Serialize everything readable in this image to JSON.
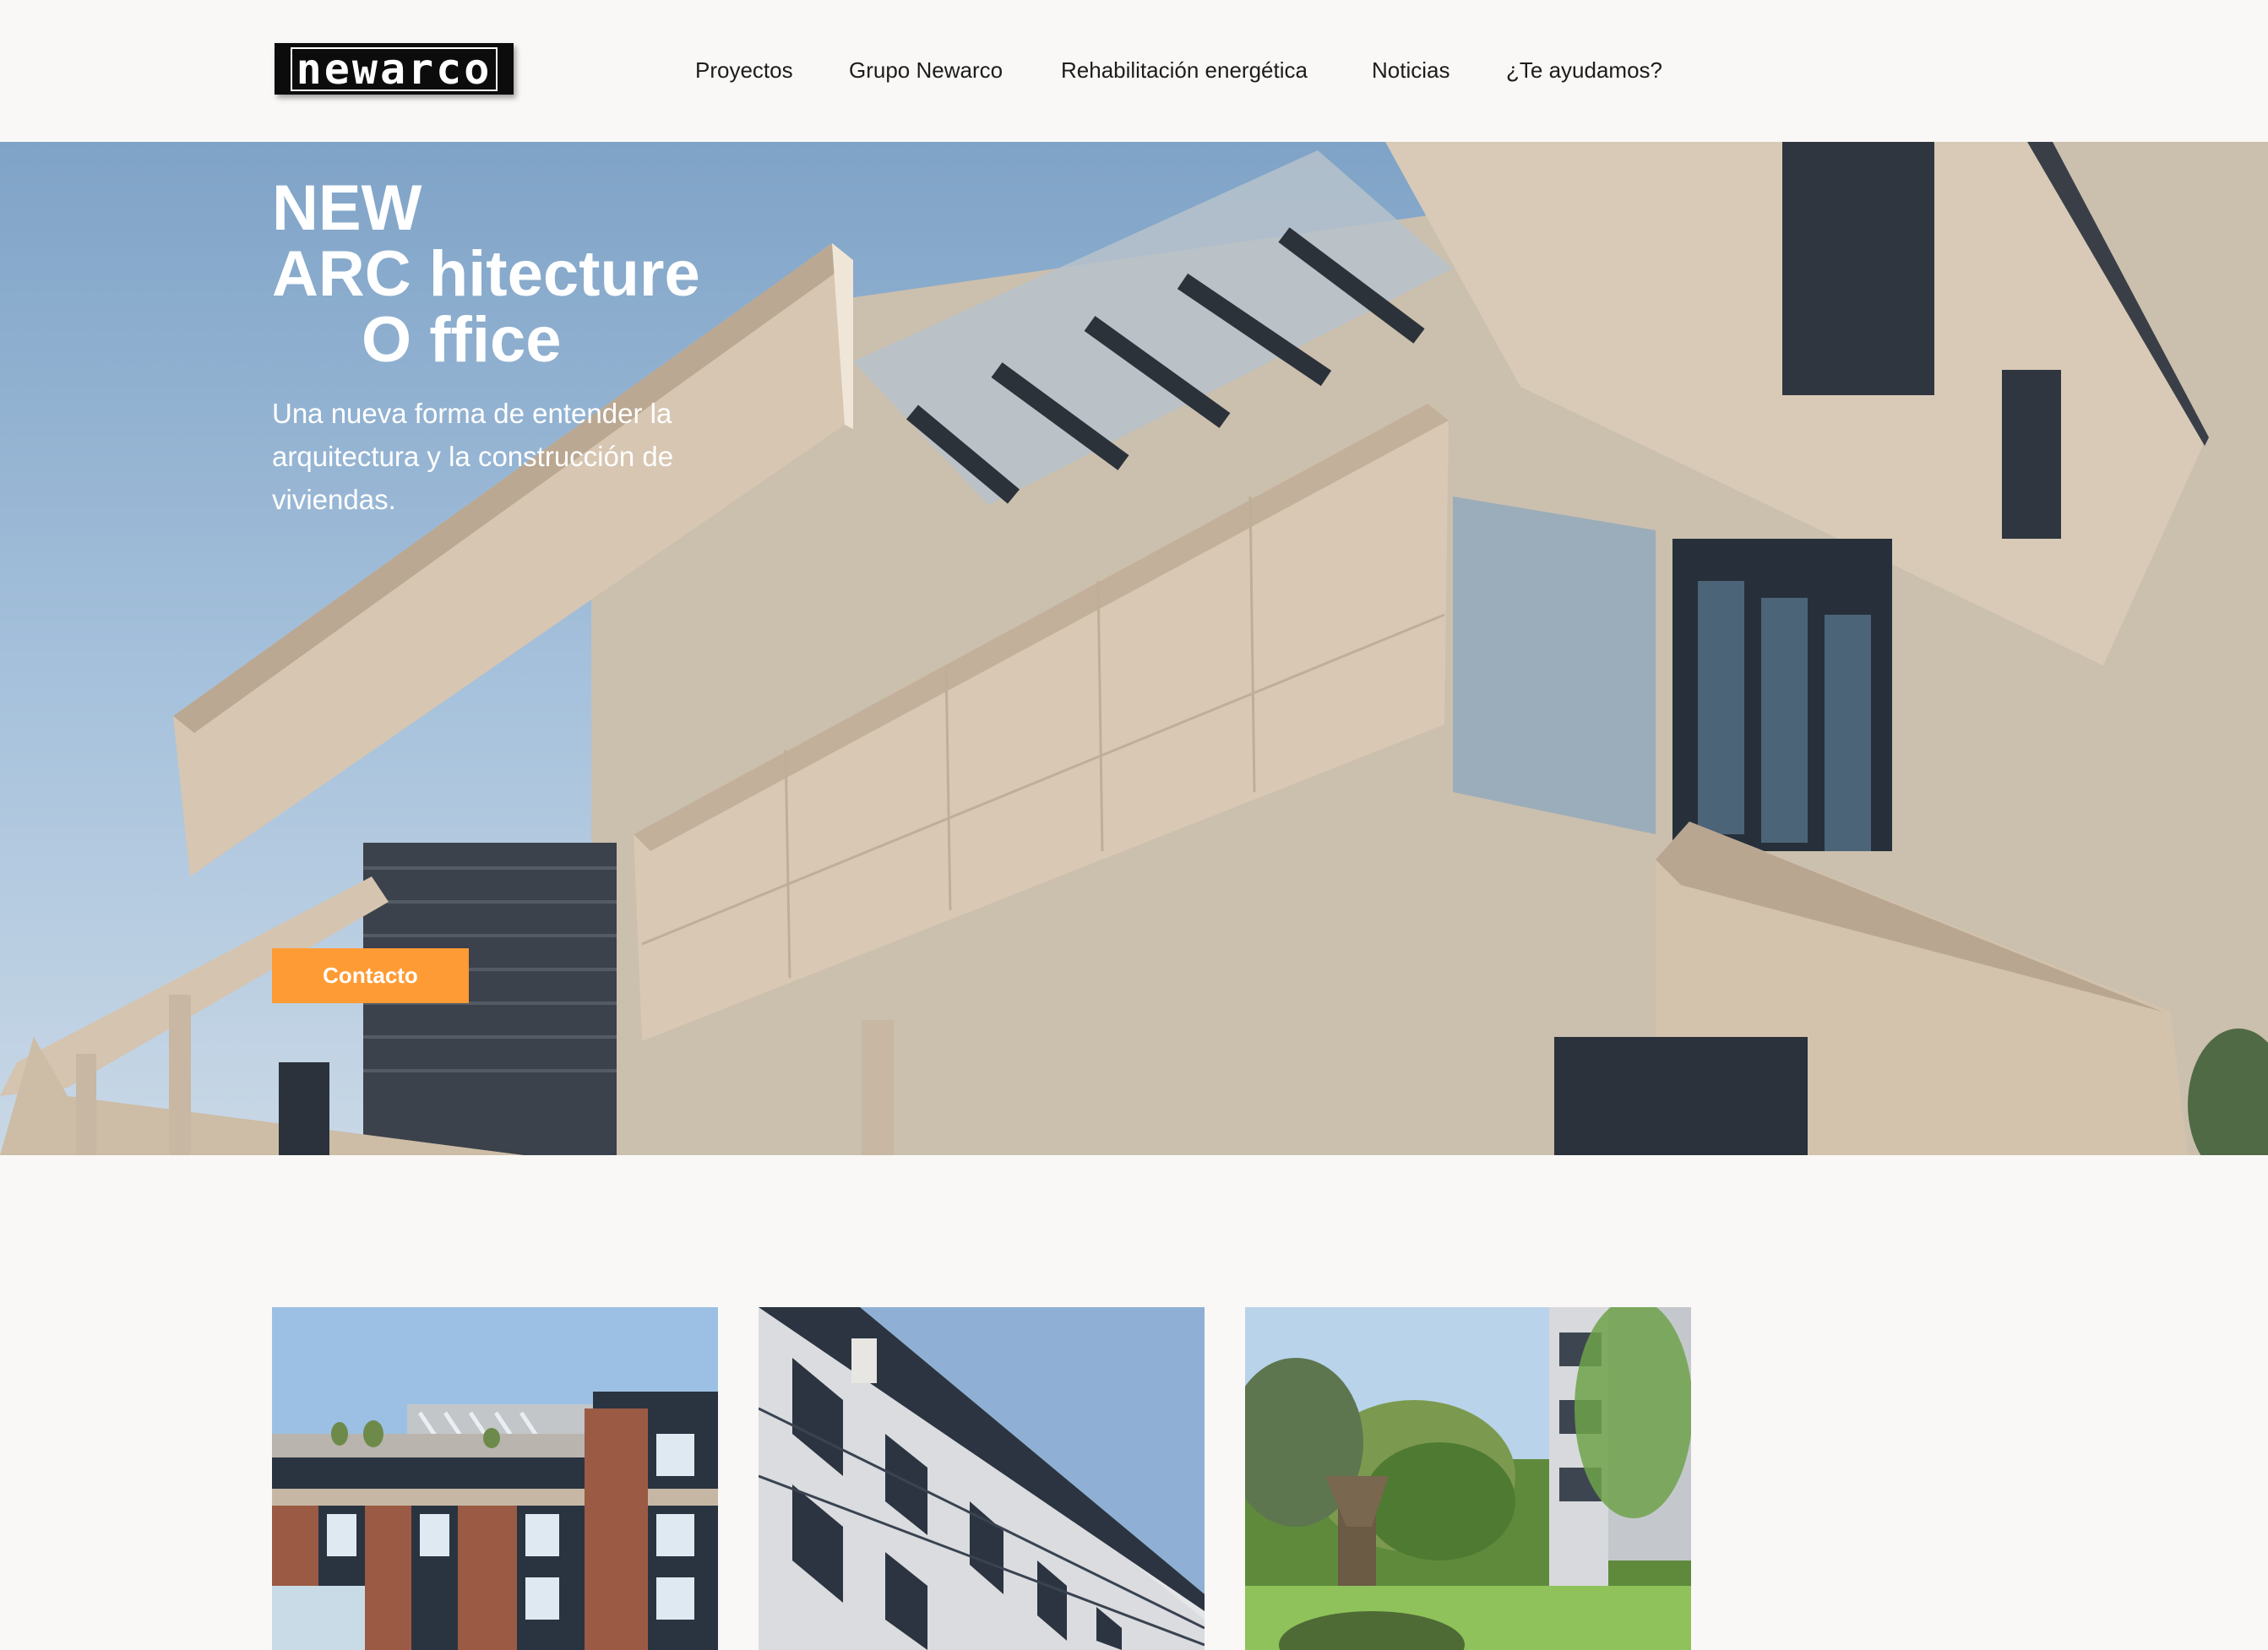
{
  "header": {
    "logo_text": "newarco",
    "nav": [
      {
        "label": "Proyectos"
      },
      {
        "label": "Grupo Newarco"
      },
      {
        "label": "Rehabilitación energética"
      },
      {
        "label": "Noticias"
      },
      {
        "label": "¿Te ayudamos?"
      }
    ]
  },
  "hero": {
    "title_lines": [
      "NEW",
      "ARC hitecture",
      "O ffice"
    ],
    "subtitle": "Una nueva forma de entender la arquitectura y la construcción de viviendas.",
    "cta_label": "Contacto"
  },
  "colors": {
    "background": "#faf8f6",
    "accent": "#ff9b34",
    "logo": "#0c0c0c",
    "text": "#1c1c1c"
  },
  "projects": [
    {
      "image": "brick-and-navy-apartment-building"
    },
    {
      "image": "white-panel-facade-building"
    },
    {
      "image": "garden-with-olive-tree"
    }
  ]
}
